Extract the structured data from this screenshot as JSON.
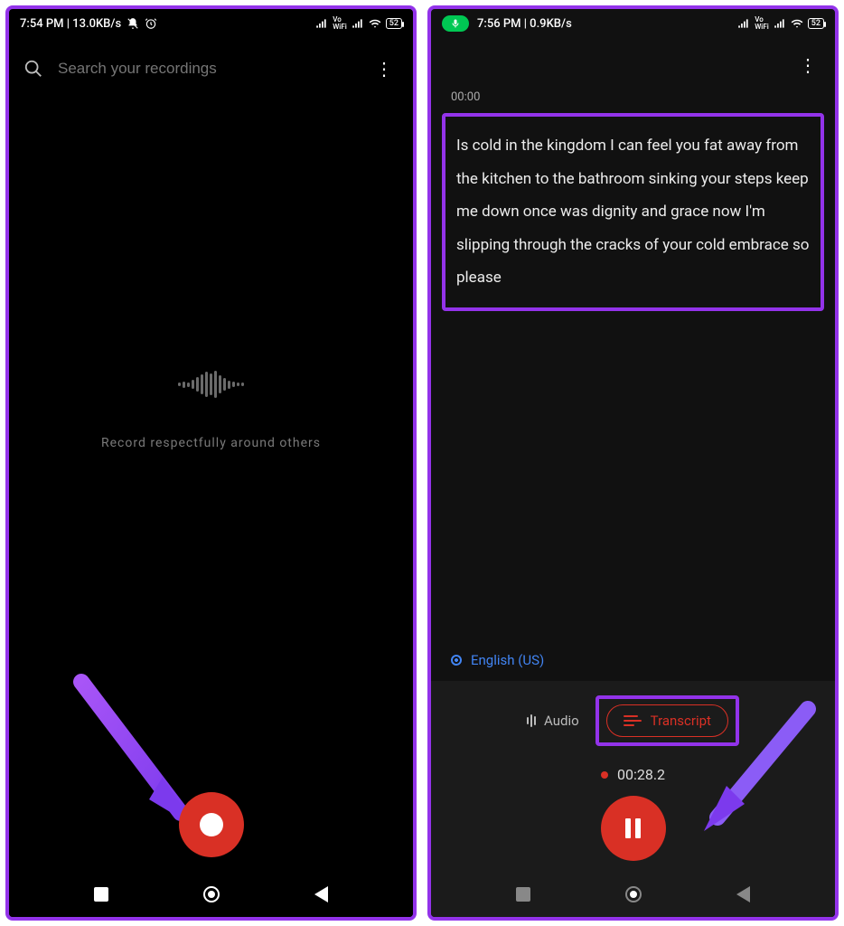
{
  "left": {
    "status": {
      "time_net": "7:54 PM | 13.0KB/s",
      "battery": "52"
    },
    "search": {
      "placeholder": "Search your recordings"
    },
    "hint": "Record respectfully around others"
  },
  "right": {
    "status": {
      "time_net": "7:56 PM | 0.9KB/s",
      "battery": "52"
    },
    "timestamp": "00:00",
    "transcript": "Is cold in the kingdom I can feel you fat away from the kitchen to the bathroom sinking your steps keep me down once was dignity and grace now I'm slipping through the cracks of your cold embrace so please",
    "language": "English (US)",
    "mode_audio": "Audio",
    "mode_transcript": "Transcript",
    "timer": "00:28.2"
  }
}
